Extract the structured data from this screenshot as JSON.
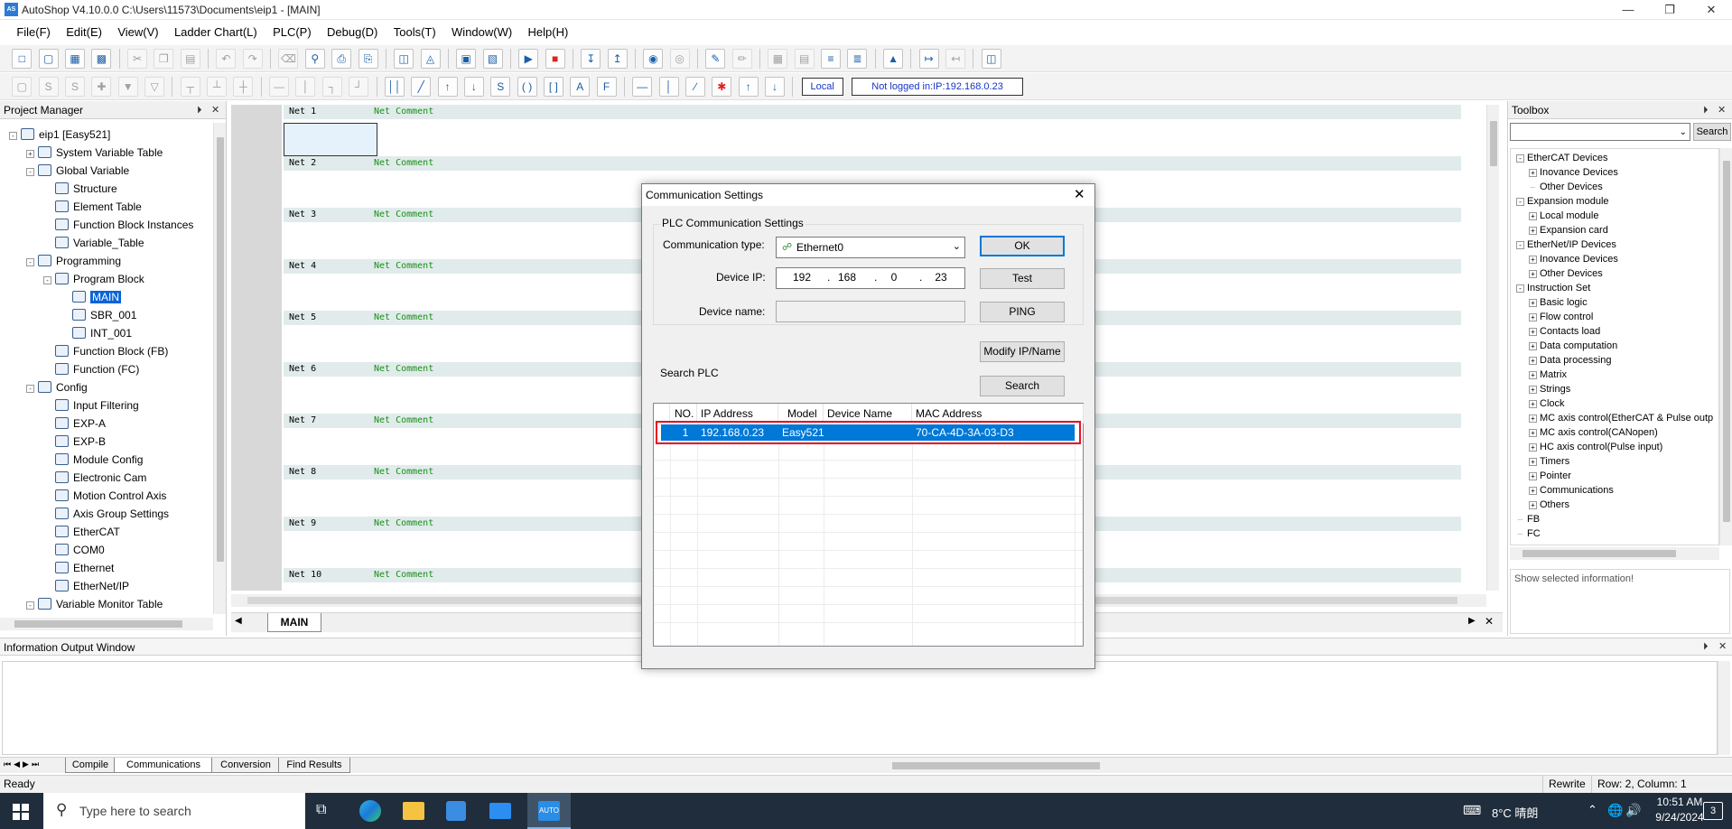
{
  "window": {
    "app_icon": "autoshop-icon",
    "title": "AutoShop V4.10.0.0  C:\\Users\\11573\\Documents\\eip1 - [MAIN]"
  },
  "menu": [
    "File(F)",
    "Edit(E)",
    "View(V)",
    "Ladder Chart(L)",
    "PLC(P)",
    "Debug(D)",
    "Tools(T)",
    "Window(W)",
    "Help(H)"
  ],
  "toolbar2": {
    "local_label": "Local",
    "login_status": "Not logged in:IP:192.168.0.23"
  },
  "project_manager": {
    "title": "Project Manager",
    "tree": [
      {
        "label": "eip1 [Easy521]",
        "depth": 0,
        "exp": "-",
        "icon": "computer-icon"
      },
      {
        "label": "System Variable Table",
        "depth": 1,
        "exp": "+",
        "icon": "globe-icon"
      },
      {
        "label": "Global Variable",
        "depth": 1,
        "exp": "-",
        "icon": "globe-icon"
      },
      {
        "label": "Structure",
        "depth": 2,
        "exp": "",
        "icon": "structure-icon"
      },
      {
        "label": "Element Table",
        "depth": 2,
        "exp": "",
        "icon": "table-icon"
      },
      {
        "label": "Function Block Instances",
        "depth": 2,
        "exp": "",
        "icon": "cube-icon"
      },
      {
        "label": "Variable_Table",
        "depth": 2,
        "exp": "",
        "icon": "globe-icon"
      },
      {
        "label": "Programming",
        "depth": 1,
        "exp": "-",
        "icon": "program-icon"
      },
      {
        "label": "Program Block",
        "depth": 2,
        "exp": "-",
        "icon": "blocks-icon"
      },
      {
        "label": "MAIN",
        "depth": 3,
        "exp": "",
        "icon": "ladder-file-icon",
        "selected": true
      },
      {
        "label": "SBR_001",
        "depth": 3,
        "exp": "",
        "icon": "ladder-file-icon"
      },
      {
        "label": "INT_001",
        "depth": 3,
        "exp": "",
        "icon": "ladder-file-icon"
      },
      {
        "label": "Function Block (FB)",
        "depth": 2,
        "exp": "",
        "icon": "list-icon"
      },
      {
        "label": "Function (FC)",
        "depth": 2,
        "exp": "",
        "icon": "list-icon"
      },
      {
        "label": "Config",
        "depth": 1,
        "exp": "-",
        "icon": "config-icon"
      },
      {
        "label": "Input Filtering",
        "depth": 2,
        "exp": "",
        "icon": "waveform-icon"
      },
      {
        "label": "EXP-A",
        "depth": 2,
        "exp": "",
        "icon": "module-icon"
      },
      {
        "label": "EXP-B",
        "depth": 2,
        "exp": "",
        "icon": "module-icon"
      },
      {
        "label": "Module Config",
        "depth": 2,
        "exp": "",
        "icon": "module-config-icon"
      },
      {
        "label": "Electronic Cam",
        "depth": 2,
        "exp": "",
        "icon": "cam-icon"
      },
      {
        "label": "Motion Control Axis",
        "depth": 2,
        "exp": "",
        "icon": "axis-icon"
      },
      {
        "label": "Axis Group Settings",
        "depth": 2,
        "exp": "",
        "icon": "gear-icon"
      },
      {
        "label": "EtherCAT",
        "depth": 2,
        "exp": "",
        "icon": "ethercat-icon"
      },
      {
        "label": "COM0",
        "depth": 2,
        "exp": "",
        "icon": "serial-port-icon"
      },
      {
        "label": "Ethernet",
        "depth": 2,
        "exp": "",
        "icon": "ethernet-icon"
      },
      {
        "label": "EtherNet/IP",
        "depth": 2,
        "exp": "",
        "icon": "ethernet-ip-icon"
      },
      {
        "label": "Variable Monitor Table",
        "depth": 1,
        "exp": "-",
        "icon": "monitor-table-icon"
      }
    ]
  },
  "editor": {
    "nets": [
      {
        "label": "Net 1",
        "comment": "Net Comment"
      },
      {
        "label": "Net 2",
        "comment": "Net Comment"
      },
      {
        "label": "Net 3",
        "comment": "Net Comment"
      },
      {
        "label": "Net 4",
        "comment": "Net Comment"
      },
      {
        "label": "Net 5",
        "comment": "Net Comment"
      },
      {
        "label": "Net 6",
        "comment": "Net Comment"
      },
      {
        "label": "Net 7",
        "comment": "Net Comment"
      },
      {
        "label": "Net 8",
        "comment": "Net Comment"
      },
      {
        "label": "Net 9",
        "comment": "Net Comment"
      },
      {
        "label": "Net 10",
        "comment": "Net Comment"
      }
    ],
    "tab": "MAIN"
  },
  "toolbox": {
    "title": "Toolbox",
    "search_button": "Search",
    "items": [
      {
        "label": "EtherCAT Devices",
        "depth": 0,
        "exp": "-"
      },
      {
        "label": "Inovance Devices",
        "depth": 1,
        "exp": "+"
      },
      {
        "label": "Other Devices",
        "depth": 1,
        "exp": ""
      },
      {
        "label": "Expansion module",
        "depth": 0,
        "exp": "-"
      },
      {
        "label": "Local module",
        "depth": 1,
        "exp": "+"
      },
      {
        "label": "Expansion card",
        "depth": 1,
        "exp": "+"
      },
      {
        "label": "EtherNet/IP Devices",
        "depth": 0,
        "exp": "-"
      },
      {
        "label": "Inovance Devices",
        "depth": 1,
        "exp": "+"
      },
      {
        "label": "Other Devices",
        "depth": 1,
        "exp": "+"
      },
      {
        "label": "Instruction Set",
        "depth": 0,
        "exp": "-"
      },
      {
        "label": "Basic logic",
        "depth": 1,
        "exp": "+"
      },
      {
        "label": "Flow control",
        "depth": 1,
        "exp": "+"
      },
      {
        "label": "Contacts load",
        "depth": 1,
        "exp": "+"
      },
      {
        "label": "Data computation",
        "depth": 1,
        "exp": "+"
      },
      {
        "label": "Data processing",
        "depth": 1,
        "exp": "+"
      },
      {
        "label": "Matrix",
        "depth": 1,
        "exp": "+"
      },
      {
        "label": "Strings",
        "depth": 1,
        "exp": "+"
      },
      {
        "label": "Clock",
        "depth": 1,
        "exp": "+"
      },
      {
        "label": "MC axis control(EtherCAT & Pulse outp",
        "depth": 1,
        "exp": "+"
      },
      {
        "label": "MC axis control(CANopen)",
        "depth": 1,
        "exp": "+"
      },
      {
        "label": "HC axis control(Pulse input)",
        "depth": 1,
        "exp": "+"
      },
      {
        "label": "Timers",
        "depth": 1,
        "exp": "+"
      },
      {
        "label": "Pointer",
        "depth": 1,
        "exp": "+"
      },
      {
        "label": "Communications",
        "depth": 1,
        "exp": "+"
      },
      {
        "label": "Others",
        "depth": 1,
        "exp": "+"
      },
      {
        "label": "FB",
        "depth": 0,
        "exp": ""
      },
      {
        "label": "FC",
        "depth": 0,
        "exp": ""
      }
    ],
    "info": "Show selected information!"
  },
  "info_window": {
    "title": "Information Output Window",
    "tabs": [
      {
        "label": "Compile",
        "active": false
      },
      {
        "label": "Communications",
        "active": true
      },
      {
        "label": "Conversion",
        "active": false
      },
      {
        "label": "Find Results",
        "active": false
      }
    ]
  },
  "status": {
    "left": "Ready",
    "mode": "Rewrite",
    "position": "Row:  2, Column:  1"
  },
  "taskbar": {
    "search_placeholder": "Type here to search",
    "weather": "8°C  晴朗",
    "time": "10:51 AM",
    "date": "9/24/2024",
    "notif_count": "3"
  },
  "dialog": {
    "title": "Communication Settings",
    "group_title": "PLC Communication Settings",
    "comm_type_label": "Communication type:",
    "comm_type_value": "Ethernet0",
    "device_ip_label": "Device IP:",
    "ip": [
      "192",
      "168",
      "0",
      "23"
    ],
    "device_name_label": "Device name:",
    "device_name_value": "",
    "ok": "OK",
    "test": "Test",
    "ping": "PING",
    "modify": "Modify IP/Name",
    "search_plc_label": "Search PLC",
    "search": "Search",
    "columns": [
      "NO.",
      "IP Address",
      "Model",
      "Device Name",
      "MAC Address"
    ],
    "rows": [
      {
        "no": "1",
        "ip": "192.168.0.23",
        "model": "Easy521",
        "name": "",
        "mac": "70-CA-4D-3A-03-D3"
      }
    ],
    "highlight_color": "#e81123",
    "selection_color": "#0078d7"
  }
}
